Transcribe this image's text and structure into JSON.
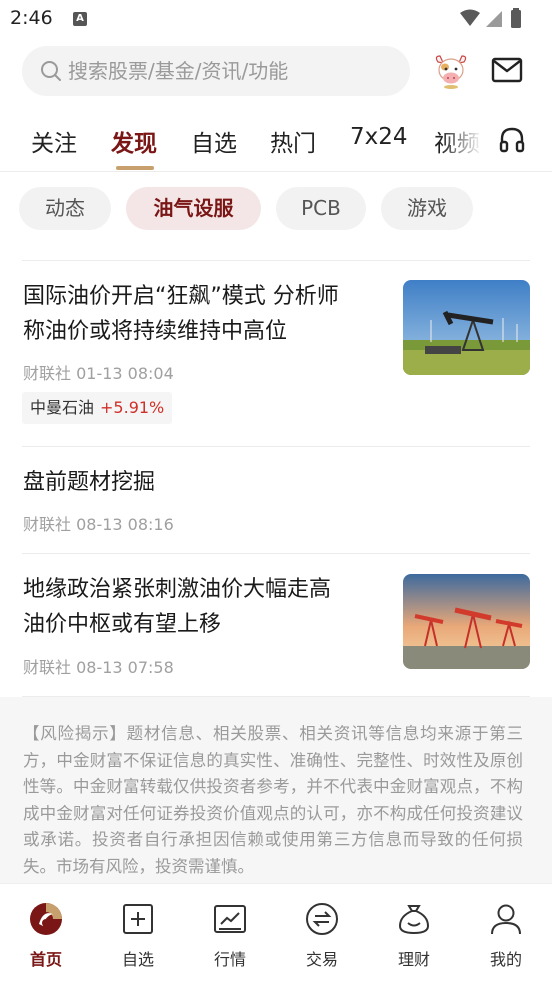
{
  "status_bar": {
    "time": "2:46",
    "notification_glyph": "A"
  },
  "search": {
    "placeholder": "搜索股票/基金/资讯/功能",
    "icons": [
      "search-icon",
      "cow-mascot-icon",
      "mail-icon"
    ]
  },
  "top_tabs": [
    {
      "label": "关注",
      "active": false
    },
    {
      "label": "发现",
      "active": true
    },
    {
      "label": "自选",
      "active": false
    },
    {
      "label": "热门",
      "active": false
    },
    {
      "label": "7x24",
      "active": false
    },
    {
      "label": "视频",
      "active": false
    }
  ],
  "chips": [
    {
      "label": "动态",
      "active": false
    },
    {
      "label": "油气设服",
      "active": true
    },
    {
      "label": "PCB",
      "active": false
    },
    {
      "label": "游戏",
      "active": false
    }
  ],
  "news": [
    {
      "title_line1": "国际油价开启“狂飙”模式 分析师",
      "title_line2": "称油价或将持续维持中高位",
      "source": "财联社 01-13 08:04",
      "stock_tag": {
        "name": "中曼石油",
        "change": "+5.91%"
      },
      "thumbnail": "oil-pump-field-photo"
    },
    {
      "title_line1": "盘前题材挖掘",
      "source": "财联社 08-13 08:16"
    },
    {
      "title_line1": "地缘政治紧张刺激油价大幅走高",
      "title_line2": "油价中枢或有望上移",
      "source": "财联社 08-13 07:58",
      "thumbnail": "oil-pumps-sunset-photo"
    }
  ],
  "disclaimer": "【风险揭示】题材信息、相关股票、相关资讯等信息均来源于第三方，中金财富不保证信息的真实性、准确性、完整性、时效性及原创性等。中金财富转载仅供投资者参考，并不代表中金财富观点，不构成中金财富对任何证券投资价值观点的认可，亦不构成任何投资建议或承诺。投资者自行承担因信赖或使用第三方信息而导致的任何损失。市场有风险，投资需谨慎。",
  "bottom_nav": [
    {
      "label": "首页",
      "icon": "home-logo-icon",
      "active": true
    },
    {
      "label": "自选",
      "icon": "add-square-icon",
      "active": false
    },
    {
      "label": "行情",
      "icon": "chart-icon",
      "active": false
    },
    {
      "label": "交易",
      "icon": "exchange-icon",
      "active": false
    },
    {
      "label": "理财",
      "icon": "moneybag-icon",
      "active": false
    },
    {
      "label": "我的",
      "icon": "person-icon",
      "active": false
    }
  ],
  "colors": {
    "accent": "#7a1616",
    "tab_underline": "#c8a06d",
    "stock_up": "#d0302a"
  }
}
